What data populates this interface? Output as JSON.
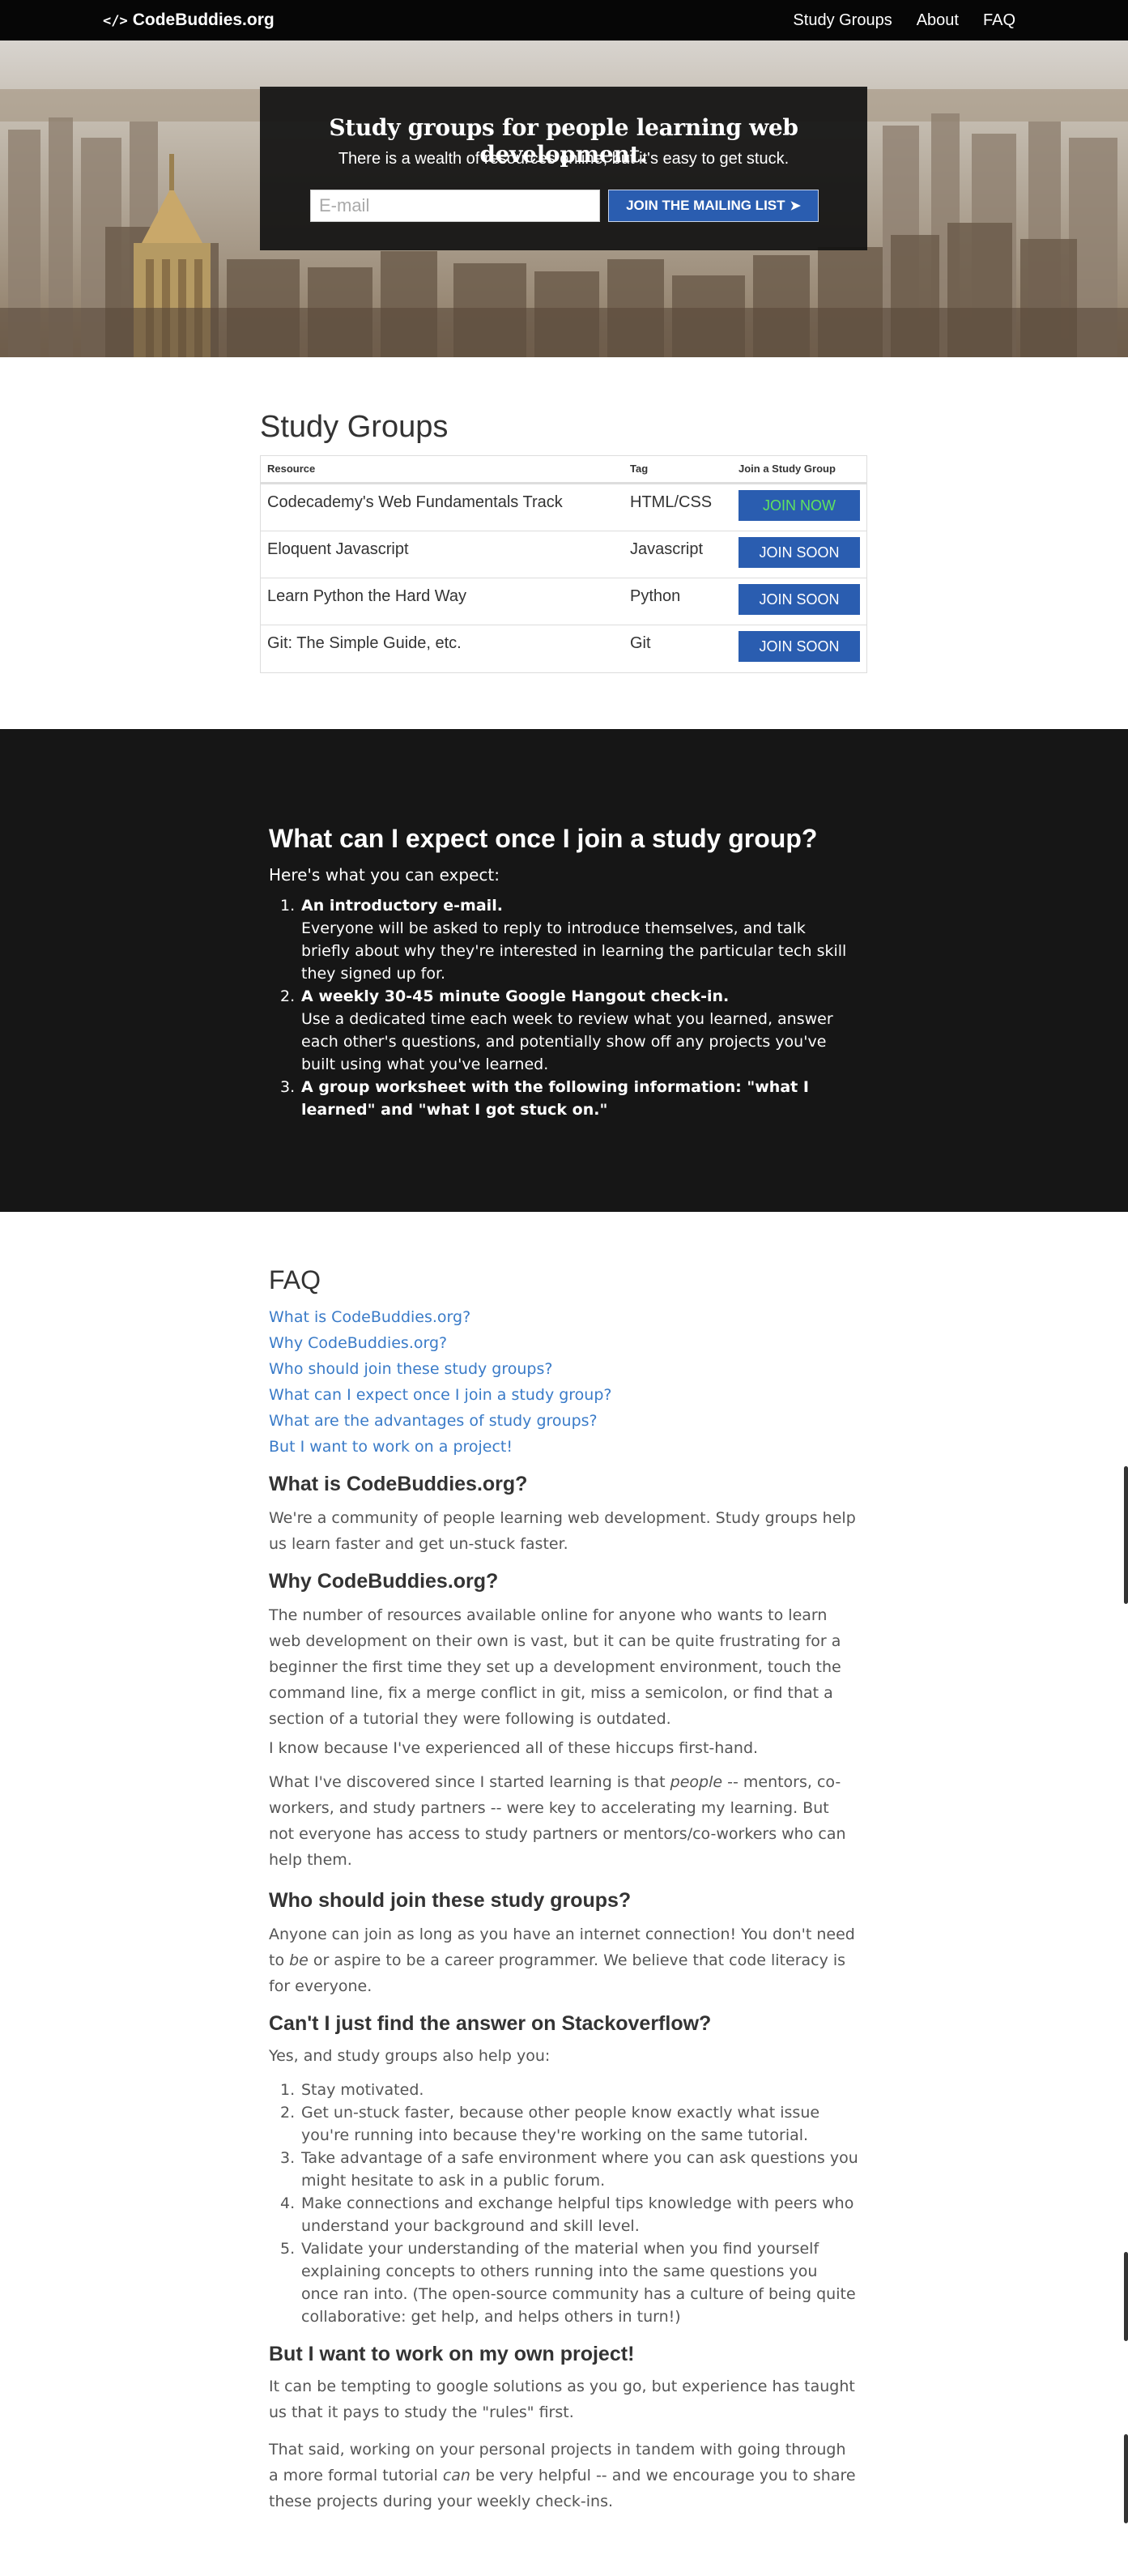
{
  "nav": {
    "brand_icon": "</>",
    "brand": "CodeBuddies.org",
    "links": [
      "Study Groups",
      "About",
      "FAQ"
    ]
  },
  "hero": {
    "title": "Study groups for people learning web development.",
    "subtitle": "There is a wealth of resources online, but it's easy to get stuck.",
    "email_placeholder": "E-mail",
    "button_label": "JOIN THE MAILING LIST",
    "button_icon": "paper-plane-icon"
  },
  "study_groups": {
    "title": "Study Groups",
    "headers": [
      "Resource",
      "Tag",
      "Join a Study Group"
    ],
    "rows": [
      {
        "resource": "Codecademy's Web Fundamentals Track",
        "tag": "HTML/CSS",
        "button": "JOIN NOW"
      },
      {
        "resource": "Eloquent Javascript",
        "tag": "Javascript",
        "button": "JOIN SOON"
      },
      {
        "resource": "Learn Python the Hard Way",
        "tag": "Python",
        "button": "JOIN SOON"
      },
      {
        "resource": "Git: The Simple Guide, etc.",
        "tag": "Git",
        "button": "JOIN SOON"
      }
    ]
  },
  "expect": {
    "title": "What can I expect once I join a study group?",
    "lead": "Here's what you can expect:",
    "items": [
      {
        "strong": "An introductory e-mail.",
        "text": "Everyone will be asked to reply to introduce themselves, and talk briefly about why they're interested in learning the particular tech skill they signed up for."
      },
      {
        "strong": "A weekly 30-45 minute Google Hangout check-in.",
        "text": "Use a dedicated time each week to review what you learned, answer each other's questions, and potentially show off any projects you've built using what you've learned."
      },
      {
        "strong": "A group worksheet with the following information: \"what I learned\" and \"what I got stuck on.\"",
        "text": ""
      }
    ]
  },
  "faq": {
    "title": "FAQ",
    "links": [
      "What is CodeBuddies.org?",
      "Why CodeBuddies.org?",
      "Who should join these study groups?",
      "What can I expect once I join a study group?",
      "What are the advantages of study groups?",
      "But I want to work on a project!"
    ],
    "what_is": {
      "q": "What is CodeBuddies.org?",
      "a": "We're a community of people learning web development. Study groups help us learn faster and get un-stuck faster."
    },
    "why": {
      "q": "Why CodeBuddies.org?",
      "p1": "The number of resources available online for anyone who wants to learn web development on their own is vast, but it can be quite frustrating for a beginner the first time they set up a development environment, touch the command line, fix a merge conflict in git, miss a semicolon, or find that a section of a tutorial they were following is outdated.",
      "p2": "I know because I've experienced all of these hiccups first-hand.",
      "p3_before": "What I've discovered since I started learning is that ",
      "p3_em": "people",
      "p3_after": " -- mentors, co-workers, and study partners -- were key to accelerating my learning. But not everyone has access to study partners or mentors/co-workers who can help them."
    },
    "who": {
      "q": "Who should join these study groups?",
      "a_before": "Anyone can join as long as you have an internet connection! You don't need to ",
      "a_em": "be",
      "a_after": " or aspire to be a career programmer. We believe that code literacy is for everyone."
    },
    "stackoverflow": {
      "q": "Can't I just find the answer on Stackoverflow?",
      "lead": "Yes, and study groups also help you:",
      "items": [
        "Stay motivated.",
        "Get un-stuck faster, because other people know exactly what issue you're running into because they're working on the same tutorial.",
        "Take advantage of a safe environment where you can ask questions you might hesitate to ask in a public forum.",
        "Make connections and exchange helpful tips knowledge with peers who understand your background and skill level.",
        "Validate your understanding of the material when you find yourself explaining concepts to others running into the same questions you once ran into. (The open-source community has a culture of being quite collaborative: get help, and helps others in turn!)"
      ]
    },
    "project": {
      "q": "But I want to work on my own project!",
      "p1": "It can be tempting to google solutions as you go, but experience has taught us that it pays to study the \"rules\" first.",
      "p2_before": "That said, working on your personal projects in tandem with going through a more formal tutorial ",
      "p2_em": "can",
      "p2_after": " be very helpful -- and we encourage you to share these projects during your weekly check-ins."
    }
  }
}
